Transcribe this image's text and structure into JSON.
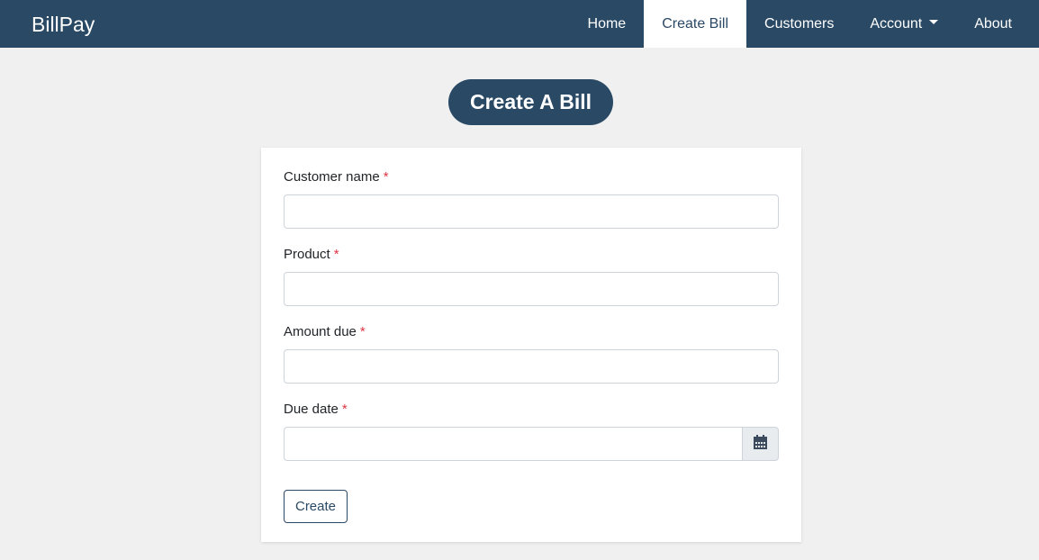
{
  "navbar": {
    "brand": "BillPay",
    "items": [
      {
        "label": "Home"
      },
      {
        "label": "Create Bill"
      },
      {
        "label": "Customers"
      },
      {
        "label": "Account"
      },
      {
        "label": "About"
      }
    ],
    "active_item": "Create Bill",
    "background_color": "#2a4965"
  },
  "page": {
    "title": "Create A Bill"
  },
  "form": {
    "customer_name": {
      "label": "Customer name",
      "required_mark": "*",
      "value": ""
    },
    "product": {
      "label": "Product",
      "required_mark": "*",
      "value": ""
    },
    "amount_due": {
      "label": "Amount due",
      "required_mark": "*",
      "value": ""
    },
    "due_date": {
      "label": "Due date",
      "required_mark": "*",
      "value": "",
      "icon": "calendar-icon"
    },
    "submit_label": "Create"
  }
}
